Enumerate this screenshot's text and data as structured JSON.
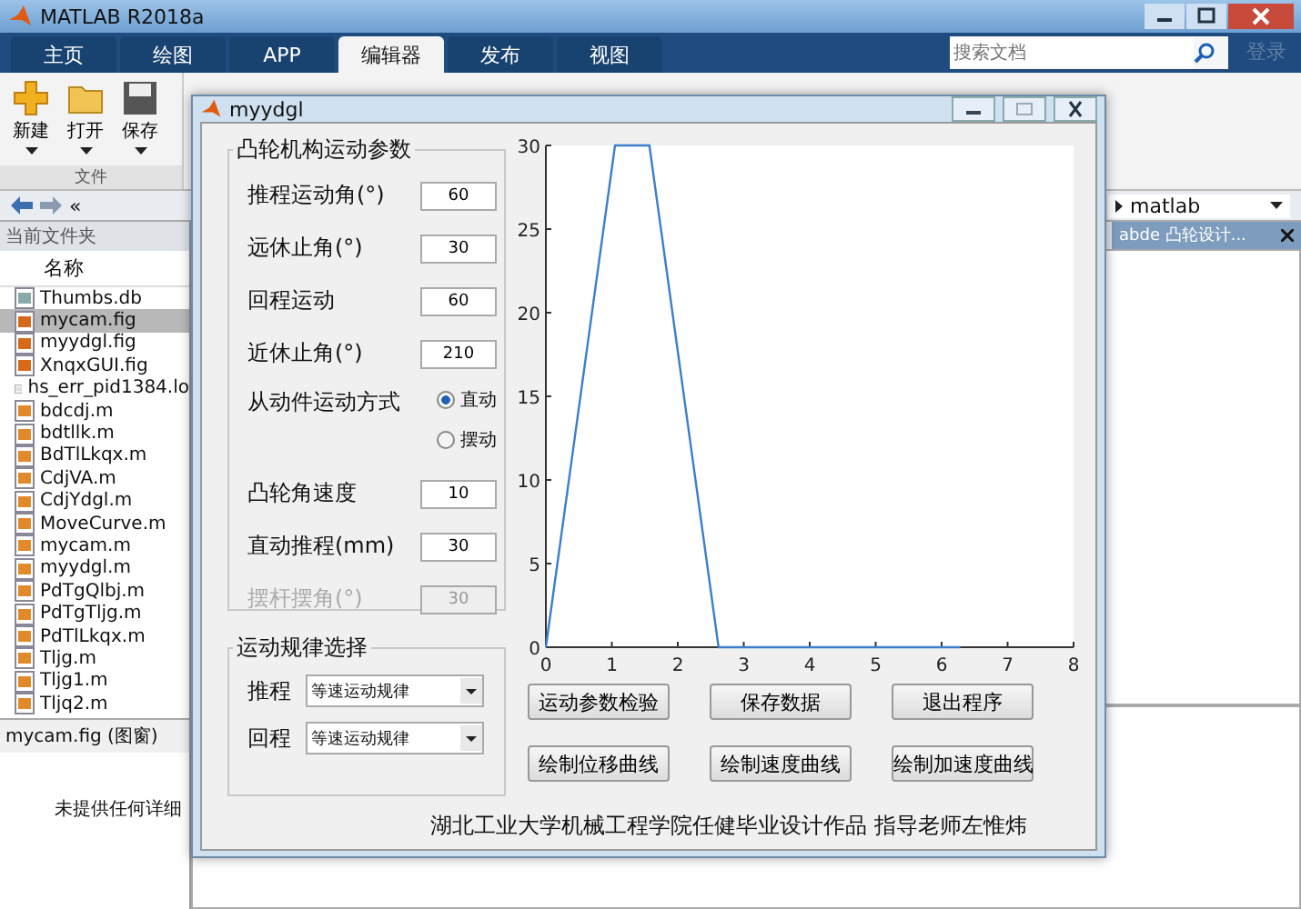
{
  "app_window": {
    "title": "MATLAB R2018a"
  },
  "ribbon_tabs": [
    {
      "label": "主页",
      "selected": false
    },
    {
      "label": "绘图",
      "selected": false
    },
    {
      "label": "APP",
      "selected": false
    },
    {
      "label": "编辑器",
      "selected": true
    },
    {
      "label": "发布",
      "selected": false
    },
    {
      "label": "视图",
      "selected": false
    }
  ],
  "search": {
    "placeholder": "搜索文档"
  },
  "sign_in": "登录",
  "toolstrip": {
    "buttons": [
      {
        "label": "新建",
        "kind": "new"
      },
      {
        "label": "打开",
        "kind": "open"
      },
      {
        "label": "保存",
        "kind": "save"
      }
    ],
    "section": "文件"
  },
  "address": {
    "chevrons": "«",
    "folder": "matlab"
  },
  "current_folder": {
    "title": "当前文件夹",
    "column": "名称",
    "files": [
      {
        "name": "Thumbs.db",
        "kind": "db",
        "selected": false
      },
      {
        "name": "mycam.fig",
        "kind": "fig",
        "selected": true
      },
      {
        "name": "myydgl.fig",
        "kind": "fig",
        "selected": false
      },
      {
        "name": "XnqxGUI.fig",
        "kind": "fig",
        "selected": false
      },
      {
        "name": "hs_err_pid1384.lo",
        "kind": "text",
        "selected": false
      },
      {
        "name": "bdcdj.m",
        "kind": "m",
        "selected": false
      },
      {
        "name": "bdtllk.m",
        "kind": "m",
        "selected": false
      },
      {
        "name": "BdTlLkqx.m",
        "kind": "m",
        "selected": false
      },
      {
        "name": "CdjVA.m",
        "kind": "m",
        "selected": false
      },
      {
        "name": "CdjYdgl.m",
        "kind": "m",
        "selected": false
      },
      {
        "name": "MoveCurve.m",
        "kind": "m",
        "selected": false
      },
      {
        "name": "mycam.m",
        "kind": "m",
        "selected": false
      },
      {
        "name": "myydgl.m",
        "kind": "m",
        "selected": false
      },
      {
        "name": "PdTgQlbj.m",
        "kind": "m",
        "selected": false
      },
      {
        "name": "PdTgTljg.m",
        "kind": "m",
        "selected": false
      },
      {
        "name": "PdTlLkqx.m",
        "kind": "m",
        "selected": false
      },
      {
        "name": "Tljg.m",
        "kind": "m",
        "selected": false
      },
      {
        "name": "Tljg1.m",
        "kind": "m",
        "selected": false
      },
      {
        "name": "Tljq2.m",
        "kind": "m",
        "selected": false
      }
    ],
    "details_title": "mycam.fig  (图窗)",
    "details_text": "未提供任何详细"
  },
  "editor_panel": {
    "title": "abde 凸轮设计..."
  },
  "figure_window": {
    "title": "myydgl",
    "params_panel": {
      "title": "凸轮机构运动参数",
      "rows": [
        {
          "kind": "field",
          "label": "推程运动角(°)",
          "value": "60",
          "disabled": false
        },
        {
          "kind": "field",
          "label": "远休止角(°)",
          "value": "30",
          "disabled": false
        },
        {
          "kind": "field",
          "label": "回程运动",
          "value": "60",
          "disabled": false
        },
        {
          "kind": "field",
          "label": "近休止角(°)",
          "value": "210",
          "disabled": false
        },
        {
          "kind": "radio",
          "label": "从动件运动方式",
          "options": [
            {
              "label": "直动",
              "selected": true
            },
            {
              "label": "摆动",
              "selected": false
            }
          ]
        },
        {
          "kind": "field",
          "label": "凸轮角速度",
          "value": "10",
          "disabled": false
        },
        {
          "kind": "field",
          "label": "直动推程(mm)",
          "value": "30",
          "disabled": false
        },
        {
          "kind": "field",
          "label": "摆杆摆角(°)",
          "value": "30",
          "disabled": true
        }
      ]
    },
    "chart_data": {
      "type": "line",
      "x": [
        0,
        1.047,
        1.571,
        2.618,
        6.283
      ],
      "series": [
        {
          "color": "#3b7fcc",
          "values": [
            0,
            30,
            30,
            0,
            0
          ]
        }
      ],
      "xlim": [
        0,
        8
      ],
      "ylim": [
        0,
        30
      ],
      "xticks": [
        0,
        1,
        2,
        3,
        4,
        5,
        6,
        7,
        8
      ],
      "yticks": [
        0,
        5,
        10,
        15,
        20,
        25,
        30
      ]
    },
    "law_panel": {
      "title": "运动规律选择",
      "rows": [
        {
          "label": "推程",
          "value": "等速运动规律"
        },
        {
          "label": "回程",
          "value": "等速运动规律"
        }
      ]
    },
    "buttons": [
      "运动参数检验",
      "保存数据",
      "退出程序",
      "绘制位移曲线",
      "绘制速度曲线",
      "绘制加速度曲线"
    ],
    "footer": "湖北工业大学机械工程学院任健毕业设计作品 指导老师左惟炜"
  }
}
